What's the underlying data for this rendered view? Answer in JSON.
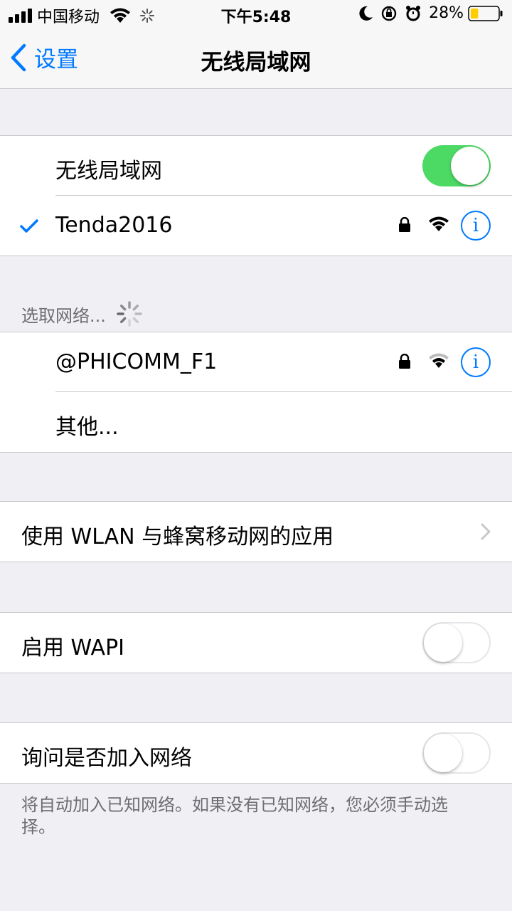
{
  "status_bar": {
    "carrier": "中国移动",
    "time": "下午5:48",
    "battery_percent": "28%",
    "battery_level": 0.28,
    "icons": [
      "signal-bars-icon",
      "wifi-icon",
      "activity-spinner-icon",
      "moon-icon",
      "rotation-lock-icon",
      "alarm-icon",
      "battery-icon"
    ]
  },
  "nav": {
    "back_label": "设置",
    "title": "无线局域网"
  },
  "wlan_group": {
    "toggle_label": "无线局域网",
    "toggle_on": true,
    "connected_network": "Tenda2016"
  },
  "choose_network": {
    "header": "选取网络...",
    "networks": [
      {
        "name": "@PHICOMM_F1",
        "secured": true
      }
    ],
    "other": "其他..."
  },
  "apps_row": {
    "label": "使用 WLAN 与蜂窝移动网的应用"
  },
  "wapi_row": {
    "label": "启用 WAPI",
    "on": false
  },
  "ask_row": {
    "label": "询问是否加入网络",
    "on": false,
    "footer": "将自动加入已知网络。如果没有已知网络，您必须手动选择。"
  },
  "colors": {
    "accent": "#007aff",
    "toggle_on": "#4cd964",
    "background": "#efeff4"
  }
}
